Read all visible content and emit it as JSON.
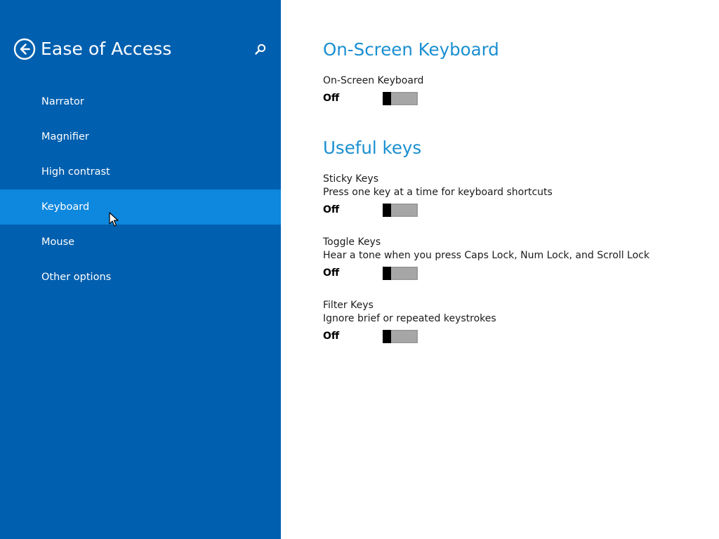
{
  "sidebar": {
    "title": "Ease of Access",
    "back_icon": "back-arrow-icon",
    "search_icon": "search-icon",
    "items": [
      {
        "label": "Narrator",
        "selected": false
      },
      {
        "label": "Magnifier",
        "selected": false
      },
      {
        "label": "High contrast",
        "selected": false
      },
      {
        "label": "Keyboard",
        "selected": true
      },
      {
        "label": "Mouse",
        "selected": false
      },
      {
        "label": "Other options",
        "selected": false
      }
    ]
  },
  "content": {
    "on_screen_keyboard": {
      "heading": "On-Screen Keyboard",
      "setting": {
        "name": "On-Screen Keyboard",
        "state": "Off",
        "on": false
      }
    },
    "useful_keys": {
      "heading": "Useful keys",
      "sticky_keys": {
        "name": "Sticky Keys",
        "description": "Press one key at a time for keyboard shortcuts",
        "state": "Off",
        "on": false
      },
      "toggle_keys": {
        "name": "Toggle Keys",
        "description": "Hear a tone when you press Caps Lock, Num Lock, and Scroll Lock",
        "state": "Off",
        "on": false
      },
      "filter_keys": {
        "name": "Filter Keys",
        "description": "Ignore brief or repeated keystrokes",
        "state": "Off",
        "on": false
      }
    }
  },
  "colors": {
    "sidebar_bg": "#005fae",
    "selected_bg": "#0e87de",
    "heading_accent": "#1a8fd1",
    "toggle_track": "#a6a6a6",
    "toggle_thumb": "#000000"
  }
}
